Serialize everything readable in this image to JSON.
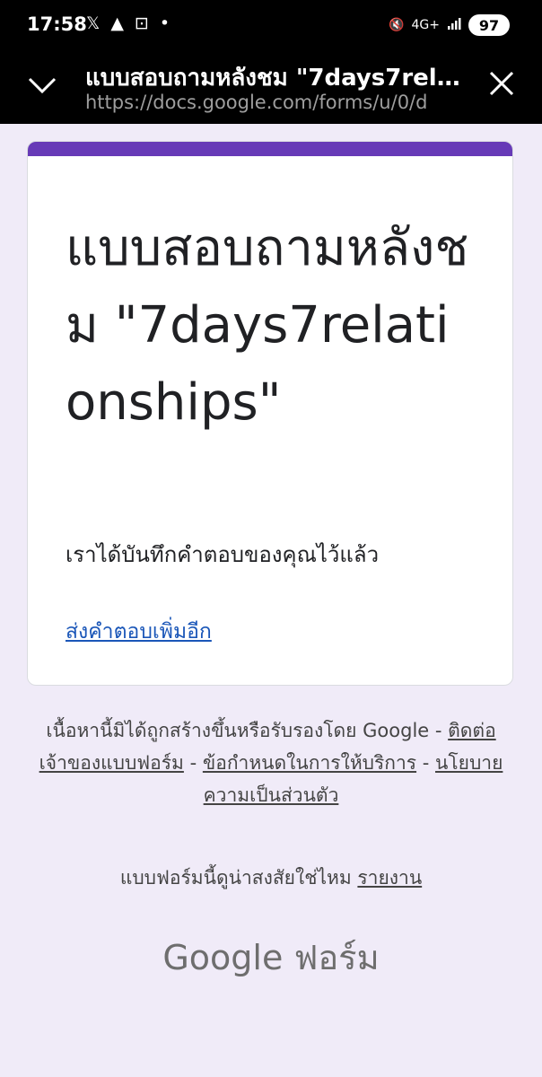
{
  "status_bar": {
    "time": "17:58",
    "network": "4G+",
    "battery": "97"
  },
  "app_bar": {
    "title": "แบบสอบถามหลังชม \"7days7relationships\"",
    "url": "https://docs.google.com/forms/u/0/d"
  },
  "card": {
    "accent_color": "#673ab7",
    "title": "แบบสอบถามหลังชม \"7days7relationships\"",
    "confirmation": "เราได้บันทึกคำตอบของคุณไว้แล้ว",
    "submit_another": "ส่งคำตอบเพิ่มอีก"
  },
  "footer": {
    "disclaimer": "เนื้อหานี้มิได้ถูกสร้างขึ้นหรือรับรองโดย Google -",
    "contact_owner": "ติดต่อเจ้าของแบบฟอร์ม",
    "terms": "ข้อกำหนดในการให้บริการ",
    "privacy": "นโยบายความเป็นส่วนตัว",
    "sep": "-",
    "suspicious": "แบบฟอร์มนี้ดูน่าสงสัยใช่ไหม",
    "report": "รายงาน",
    "brand": "Google ฟอร์ม"
  }
}
